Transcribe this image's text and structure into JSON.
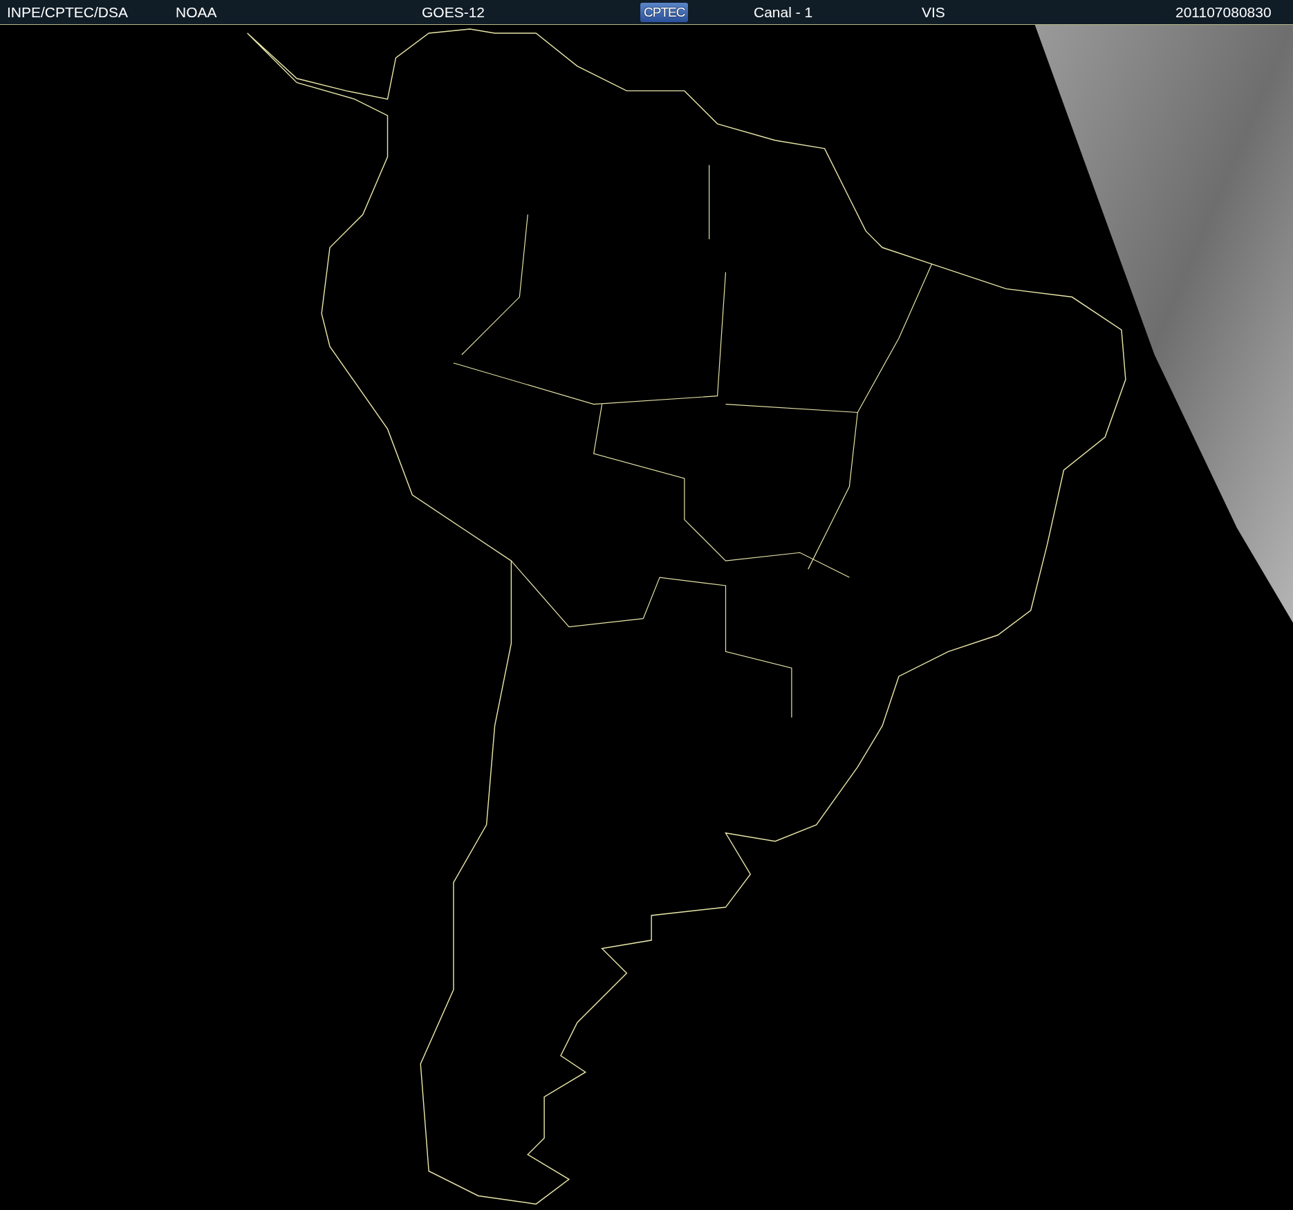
{
  "header": {
    "items": [
      {
        "kind": "text",
        "label": "INPE/CPTEC/DSA"
      },
      {
        "kind": "text",
        "label": "NOAA"
      },
      {
        "kind": "text",
        "label": "GOES-12"
      },
      {
        "kind": "logo",
        "label": "CPTEC"
      },
      {
        "kind": "text",
        "label": "Canal - 1"
      },
      {
        "kind": "text",
        "label": "VIS"
      },
      {
        "kind": "text",
        "label": "201107080830"
      }
    ]
  }
}
